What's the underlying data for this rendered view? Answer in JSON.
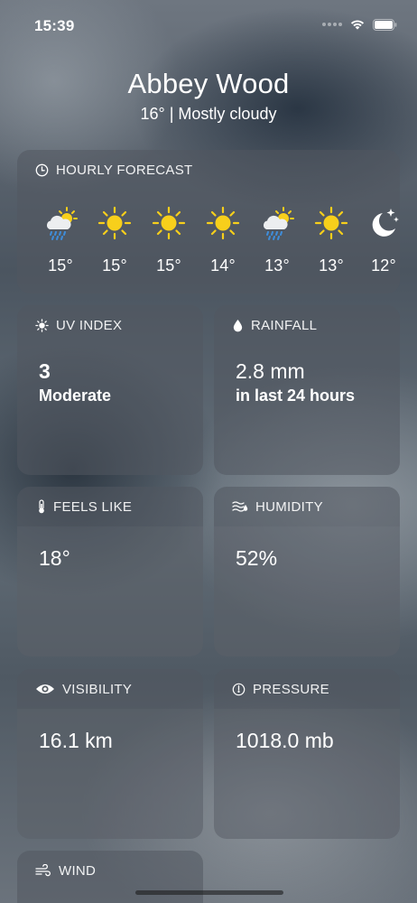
{
  "status_bar": {
    "time": "15:39"
  },
  "location": {
    "city": "Abbey Wood",
    "summary": "16° | Mostly cloudy"
  },
  "hourly": {
    "title": "HOURLY FORECAST",
    "items": [
      {
        "icon": "cloud-sun-rain-icon",
        "temp": "15°"
      },
      {
        "icon": "sun-icon",
        "temp": "15°"
      },
      {
        "icon": "sun-icon",
        "temp": "15°"
      },
      {
        "icon": "sun-icon",
        "temp": "14°"
      },
      {
        "icon": "cloud-sun-rain-icon",
        "temp": "13°"
      },
      {
        "icon": "sun-icon",
        "temp": "13°"
      },
      {
        "icon": "moon-stars-icon",
        "temp": "12°"
      }
    ]
  },
  "uv": {
    "title": "UV INDEX",
    "value": "3",
    "sub": "Moderate"
  },
  "rainfall": {
    "title": "RAINFALL",
    "value": "2.8 mm",
    "sub": "in last 24 hours"
  },
  "feels_like": {
    "title": "FEELS LIKE",
    "value": "18°"
  },
  "humidity": {
    "title": "HUMIDITY",
    "value": "52%"
  },
  "visibility": {
    "title": "VISIBILITY",
    "value": "16.1 km"
  },
  "pressure": {
    "title": "PRESSURE",
    "value": "1018.0 mb"
  },
  "wind": {
    "title": "WIND"
  },
  "colors": {
    "sun": "#F7CF1B",
    "rain": "#3E8DDB",
    "card": "#525860"
  }
}
